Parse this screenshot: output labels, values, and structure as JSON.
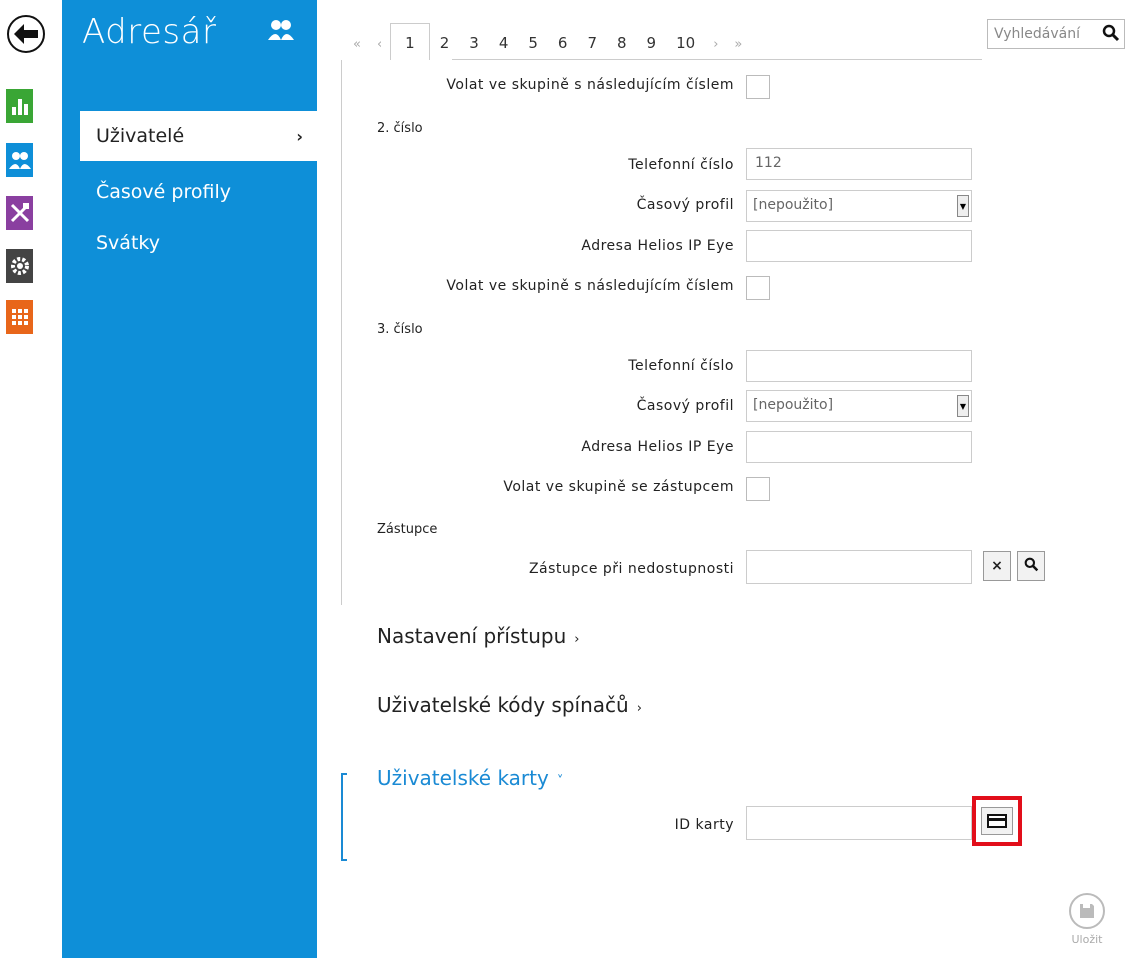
{
  "sidebar": {
    "title": "Adresář",
    "items": [
      {
        "label": "Uživatelé",
        "active": true
      },
      {
        "label": "Časové profily",
        "active": false
      },
      {
        "label": "Svátky",
        "active": false
      }
    ]
  },
  "rail": {
    "icons": [
      "status-icon",
      "directory-icon",
      "hardware-icon",
      "services-icon",
      "system-icon"
    ],
    "colors": [
      "#3aa635",
      "#0e8fd8",
      "#8a3fa0",
      "#444444",
      "#e8661a"
    ]
  },
  "pager": {
    "first": "«",
    "prev": "‹",
    "pages": [
      "1",
      "2",
      "3",
      "4",
      "5",
      "6",
      "7",
      "8",
      "9",
      "10"
    ],
    "current": "1",
    "next": "›",
    "last": "»"
  },
  "search": {
    "placeholder": "Vyhledávání"
  },
  "form": {
    "group_call_next_label": "Volat ve skupině s následujícím číslem",
    "number2": {
      "heading": "2. číslo",
      "phone_label": "Telefonní číslo",
      "phone_value": "112",
      "profile_label": "Časový profil",
      "profile_value": "[nepoužito]",
      "eye_label": "Adresa Helios IP Eye",
      "eye_value": "",
      "group_label": "Volat ve skupině s následujícím číslem"
    },
    "number3": {
      "heading": "3. číslo",
      "phone_label": "Telefonní číslo",
      "phone_value": "",
      "profile_label": "Časový profil",
      "profile_value": "[nepoužito]",
      "eye_label": "Adresa Helios IP Eye",
      "eye_value": "",
      "group_label": "Volat ve skupině se zástupcem"
    },
    "deputy": {
      "heading": "Zástupce",
      "label": "Zástupce při nedostupnosti",
      "value": "",
      "clear": "×"
    }
  },
  "sections": {
    "access": "Nastavení přístupu",
    "switch_codes": "Uživatelské kódy spínačů",
    "cards": "Uživatelské karty",
    "card_id_label": "ID karty",
    "card_id_value": ""
  },
  "save": {
    "label": "Uložit"
  }
}
